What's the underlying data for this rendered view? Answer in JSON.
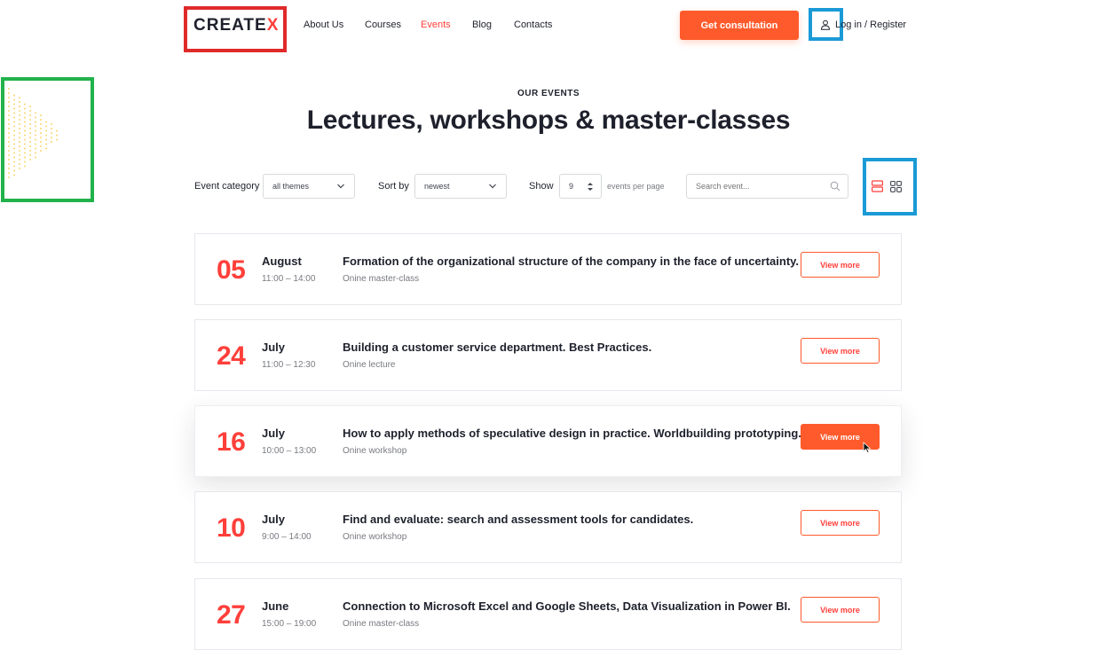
{
  "header": {
    "logo_text": "CREATE",
    "logo_accent": "X",
    "nav": [
      {
        "label": "About Us",
        "active": false
      },
      {
        "label": "Courses",
        "active": false
      },
      {
        "label": "Events",
        "active": true
      },
      {
        "label": "Blog",
        "active": false
      },
      {
        "label": "Contacts",
        "active": false
      }
    ],
    "consult_label": "Get consultation",
    "login_label": "Log in / Register"
  },
  "hero": {
    "eyebrow": "OUR EVENTS",
    "title": "Lectures, workshops & master-classes"
  },
  "filters": {
    "category_label": "Event category",
    "category_value": "all themes",
    "sort_label": "Sort by",
    "sort_value": "newest",
    "show_label": "Show",
    "show_value": "9",
    "per_page_label": "events per page",
    "search_placeholder": "Search event..."
  },
  "events": [
    {
      "day": "05",
      "month": "August",
      "time": "11:00 – 14:00",
      "title": "Formation of the organizational structure of the company in the face of uncertainty.",
      "type": "Onine master-class",
      "button": "View more"
    },
    {
      "day": "24",
      "month": "July",
      "time": "11:00 – 12:30",
      "title": "Building a customer service department. Best Practices.",
      "type": "Onine lecture",
      "button": "View more"
    },
    {
      "day": "16",
      "month": "July",
      "time": "10:00 – 13:00",
      "title": "How to apply methods of speculative design in practice. Worldbuilding prototyping.",
      "type": "Onine workshop",
      "button": "View more"
    },
    {
      "day": "10",
      "month": "July",
      "time": "9:00 – 14:00",
      "title": "Find and evaluate: search and assessment tools for candidates.",
      "type": "Onine workshop",
      "button": "View more"
    },
    {
      "day": "27",
      "month": "June",
      "time": "15:00 – 19:00",
      "title": "Connection to Microsoft Excel and Google Sheets, Data Visualization in Power BI.",
      "type": "Onine master-class",
      "button": "View more"
    }
  ],
  "colors": {
    "accent": "#ff3f3a",
    "button_gradient": "#ff5a2b",
    "text_dark": "#1e212c",
    "text_muted": "#787a80",
    "highlight_red": "#e02a2a",
    "highlight_blue": "#1a9ad6",
    "highlight_green": "#21b24b",
    "dots_yellow": "#f5c842"
  },
  "icons": [
    "user-icon",
    "chevron-down-icon",
    "stepper-arrows-icon",
    "search-icon",
    "list-view-icon",
    "grid-view-icon",
    "cursor-icon"
  ]
}
